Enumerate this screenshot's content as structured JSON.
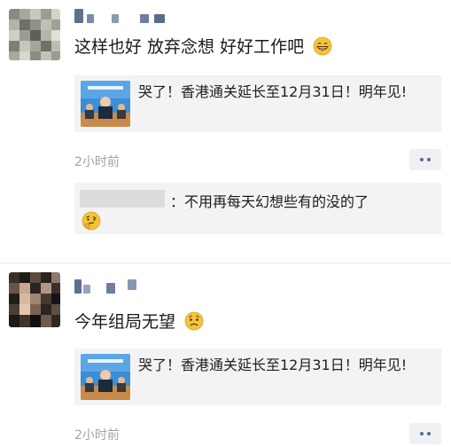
{
  "posts": [
    {
      "text": "这样也好 放弃念想 好好工作吧",
      "emoji": "grinning-face",
      "link_title": "哭了！香港通关延长至12月31日！明年见!",
      "time": "2小时前",
      "comment_text": "：不用再每天幻想些有的没的了",
      "comment_emoji": "thinking-face"
    },
    {
      "text": "今年组局无望",
      "emoji": "worried-face",
      "link_title": "哭了！香港通关延长至12月31日！明年见!",
      "time": "2小时前"
    }
  ],
  "colors": {
    "link_blue": "#576b95",
    "card_bg": "#f3f3f5",
    "time_gray": "#a3a3a3",
    "emoji_yellow": "#f5c33b"
  }
}
